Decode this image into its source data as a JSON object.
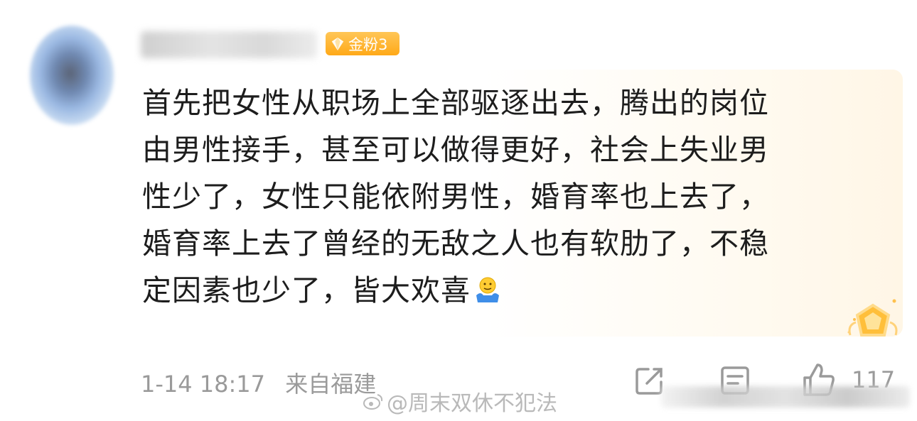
{
  "comment": {
    "badge_label": "金粉3",
    "lines": [
      "首先把女性从职场上全部驱逐出去，腾出的岗位",
      "由男性接手，甚至可以做得更好，社会上失业男",
      "性少了，女性只能依附男性，婚育率也上去了，",
      "婚育率上去了曾经的无敌之人也有软肋了，不稳",
      "定因素也少了，皆大欢喜"
    ],
    "emoji_icon": "shrug-emoji",
    "timestamp": "1-14 18:17",
    "location": "来自福建",
    "like_count": "117"
  },
  "watermark": {
    "text": "@周末双休不犯法"
  },
  "icons": {
    "badge": "gem-icon",
    "share": "share-icon",
    "comment": "comment-icon",
    "like": "thumbs-up-icon",
    "corner": "fan-badge-icon"
  },
  "colors": {
    "badge_bg": "#ffb12b",
    "text": "#1d1d1d",
    "meta": "#9a9a9a"
  }
}
